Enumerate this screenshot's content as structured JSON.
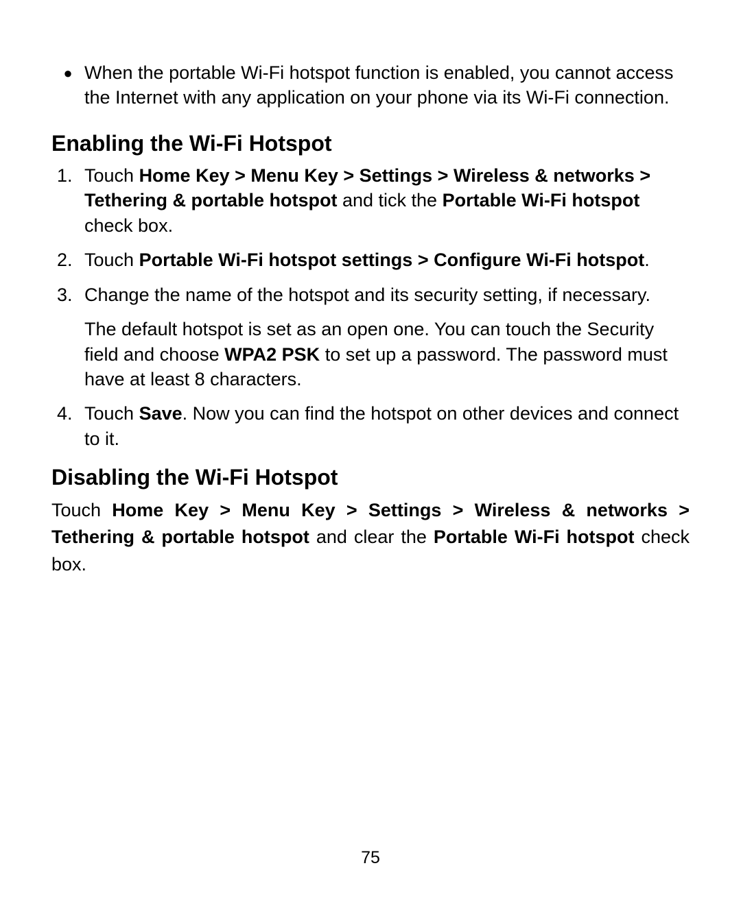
{
  "intro_bullet": "When the portable Wi-Fi hotspot function is enabled, you cannot access the Internet with any application on your phone via its Wi-Fi connection.",
  "enable": {
    "heading": "Enabling the Wi-Fi Hotspot",
    "steps": {
      "s1": {
        "num": "1.",
        "pre": "Touch ",
        "bold1": "Home Key > Menu Key > Settings > Wireless & networks > Tethering & portable hotspot",
        "mid": " and tick the ",
        "bold2": "Portable Wi-Fi hotspot",
        "post": " check box."
      },
      "s2": {
        "num": "2.",
        "pre": "Touch ",
        "bold1": "Portable Wi-Fi hotspot settings > Configure Wi-Fi hotspot",
        "post": "."
      },
      "s3": {
        "num": "3.",
        "p1": "Change the name of the hotspot and its security setting, if necessary.",
        "p2_pre": "The default hotspot is set as an open one. You can touch the Security field and choose ",
        "p2_bold": "WPA2 PSK",
        "p2_post": " to set up a password. The password must have at least 8 characters."
      },
      "s4": {
        "num": "4.",
        "pre": "Touch ",
        "bold1": "Save",
        "post": ". Now you can find the hotspot on other devices and connect to it."
      }
    }
  },
  "disable": {
    "heading": "Disabling the Wi-Fi Hotspot",
    "pre": "Touch ",
    "bold1": "Home Key > Menu Key > Settings > Wireless & networks > Tethering & portable hotspot",
    "mid": " and clear the ",
    "bold2": "Portable Wi-Fi hotspot",
    "post": " check box."
  },
  "page_number": "75",
  "bullet_char": "●"
}
